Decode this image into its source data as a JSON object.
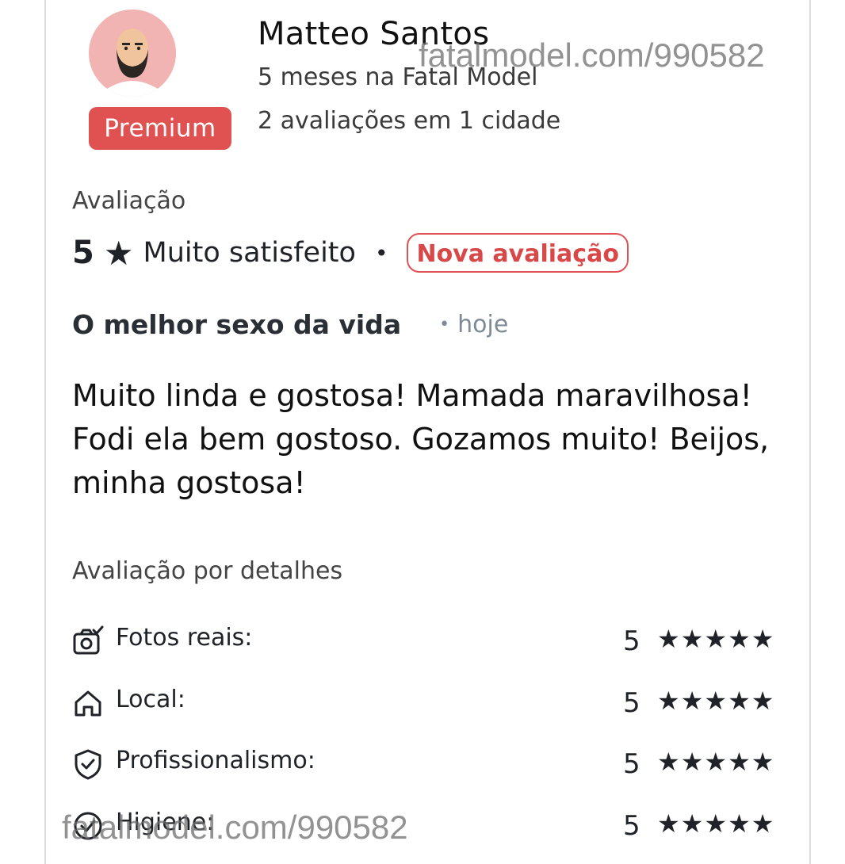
{
  "reviewer": {
    "name": "Matteo Santos",
    "tenure": "5 meses na Fatal Model",
    "review_count": "2 avaliações em 1 cidade",
    "badge": "Premium"
  },
  "rating": {
    "section_label": "Avaliação",
    "score": "5",
    "star_icon": "★",
    "label": "Muito satisfeito",
    "separator": "•",
    "new_badge": "Nova avaliação"
  },
  "review": {
    "title": "O melhor sexo da vida",
    "date_separator": "•",
    "date": "hoje",
    "body": "Muito linda e gostosa! Mamada maravilhosa! Fodi ela bem gostoso. Gozamos muito! Beijos, minha gostosa!"
  },
  "details": {
    "section_label": "Avaliação por detalhes",
    "items": [
      {
        "label": "Fotos reais:",
        "score": "5",
        "stars": "★★★★★",
        "icon": "camera-check-icon"
      },
      {
        "label": "Local:",
        "score": "5",
        "stars": "★★★★★",
        "icon": "home-icon"
      },
      {
        "label": "Profissionalismo:",
        "score": "5",
        "stars": "★★★★★",
        "icon": "shield-check-icon"
      },
      {
        "label": "Higiene:",
        "score": "5",
        "stars": "★★★★★",
        "icon": "check-circle-icon"
      }
    ]
  },
  "watermarks": {
    "top": "fatalmodel.com/990582",
    "bottom": "fatalmodel.com/990582"
  },
  "colors": {
    "accent": "#e05252",
    "avatar_bg": "#f2b3b3",
    "muted": "#7c8b95"
  }
}
